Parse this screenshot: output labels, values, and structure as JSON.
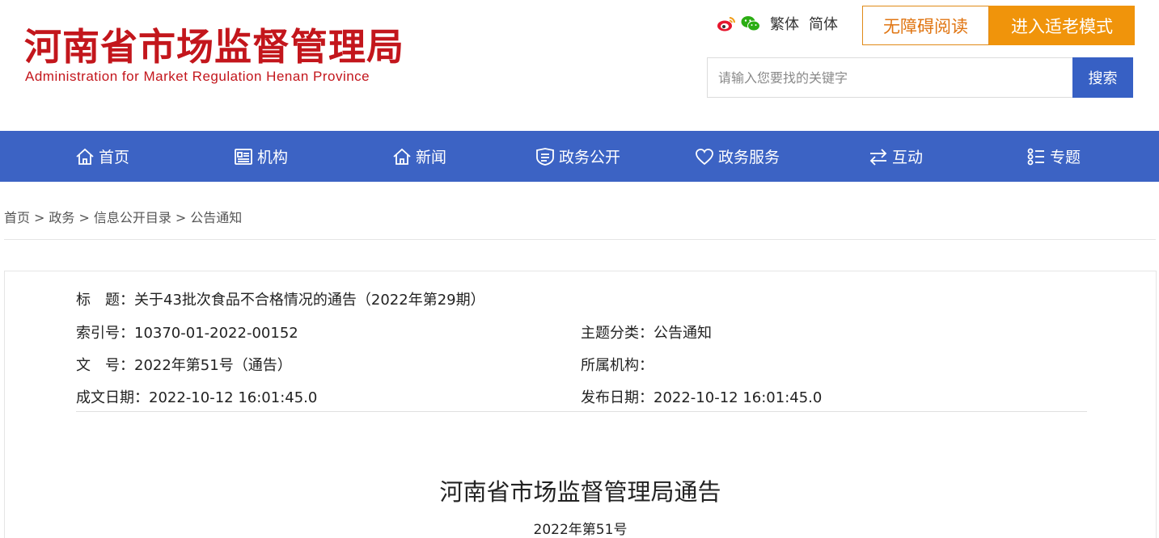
{
  "header": {
    "logo_cn": "河南省市场监督管理局",
    "logo_en": "Administration for Market Regulation Henan Province",
    "lang_traditional": "繁体",
    "lang_simplified": "简体",
    "accessible_label": "无障碍阅读",
    "elder_mode_label": "进入适老模式",
    "search_placeholder": "请输入您要找的关键字",
    "search_button": "搜索",
    "colors": {
      "brand": "#c3161c",
      "accent_orange": "#f0940b",
      "nav_blue": "#3c63c4"
    }
  },
  "nav": {
    "items": [
      {
        "label": "首页",
        "icon": "home-icon"
      },
      {
        "label": "机构",
        "icon": "org-card-icon"
      },
      {
        "label": "新闻",
        "icon": "news-home-icon"
      },
      {
        "label": "政务公开",
        "icon": "shield-list-icon"
      },
      {
        "label": "政务服务",
        "icon": "heart-icon"
      },
      {
        "label": "互动",
        "icon": "exchange-arrows-icon"
      },
      {
        "label": "专题",
        "icon": "topic-list-icon"
      }
    ]
  },
  "breadcrumb": {
    "items": [
      "首页",
      "政务",
      "信息公开目录",
      "公告通知"
    ],
    "separator": ">"
  },
  "meta": {
    "title_label": "标　题：",
    "title_value": "关于43批次食品不合格情况的通告（2022年第29期）",
    "index_label": "索引号：",
    "index_value": "10370-01-2022-00152",
    "category_label": "主题分类：",
    "category_value": "公告通知",
    "doc_no_label": "文　号：",
    "doc_no_value": "2022年第51号（通告）",
    "agency_label": "所属机构：",
    "agency_value": "",
    "created_label": "成文日期：",
    "created_value": "2022-10-12 16:01:45.0",
    "published_label": "发布日期：",
    "published_value": "2022-10-12 16:01:45.0"
  },
  "document": {
    "title": "河南省市场监督管理局通告",
    "number": "2022年第51号"
  }
}
